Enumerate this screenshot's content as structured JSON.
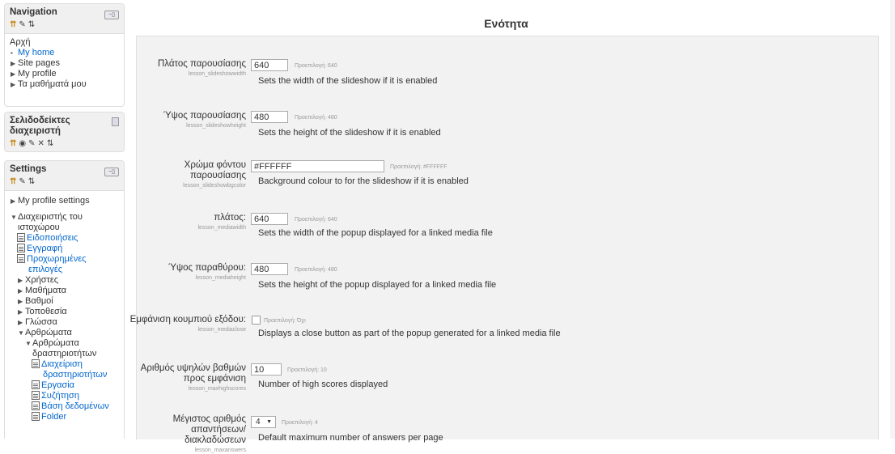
{
  "navigation": {
    "title": "Navigation",
    "home": "Αρχή",
    "items": [
      {
        "label": "My home",
        "marker": "▪"
      },
      {
        "label": "Site pages",
        "marker": "▶"
      },
      {
        "label": "My profile",
        "marker": "▶"
      },
      {
        "label": "Τα μαθήματά μου",
        "marker": "▶"
      }
    ]
  },
  "bookmarks": {
    "title_line1": "Σελιδοδείκτες",
    "title_line2": "διαχειριστή"
  },
  "settings": {
    "title": "Settings",
    "items": [
      {
        "label": "My profile settings",
        "marker": "▶"
      },
      {
        "label": "Διαχειριστής του",
        "marker": "▼"
      },
      {
        "label": "ιστοχώρου",
        "marker": ""
      },
      {
        "label": "Ειδοποιήσεις",
        "marker": "doc"
      },
      {
        "label": "Εγγραφή",
        "marker": "doc"
      },
      {
        "label": "Προχωρημένες",
        "marker": "doc"
      },
      {
        "label": "επιλογές",
        "marker": ""
      },
      {
        "label": "Χρήστες",
        "marker": "▶"
      },
      {
        "label": "Μαθήματα",
        "marker": "▶"
      },
      {
        "label": "Βαθμοί",
        "marker": "▶"
      },
      {
        "label": "Τοποθεσία",
        "marker": "▶"
      },
      {
        "label": "Γλώσσα",
        "marker": "▶"
      },
      {
        "label": "Αρθρώματα",
        "marker": "▼"
      },
      {
        "label": "Αρθρώματα",
        "marker": "▼"
      },
      {
        "label": "δραστηριοτήτων",
        "marker": ""
      },
      {
        "label": "Διαχείριση",
        "marker": "doc"
      },
      {
        "label": "δραστηριοτήτων",
        "marker": ""
      },
      {
        "label": "Εργασία",
        "marker": "doc"
      },
      {
        "label": "Συζήτηση",
        "marker": "doc"
      },
      {
        "label": "Βάση δεδομένων",
        "marker": "doc"
      },
      {
        "label": "Folder",
        "marker": "doc"
      }
    ]
  },
  "page": {
    "title": "Ενότητα"
  },
  "form": {
    "slideshowwidth": {
      "label": "Πλάτος παρουσίασης",
      "key": "lesson_slideshowwidth",
      "value": "640",
      "default": "Προεπιλογή: 640",
      "desc": "Sets the width of the slideshow if it is enabled"
    },
    "slideshowheight": {
      "label": "Ύψος παρουσίασης",
      "key": "lesson_slideshowheight",
      "value": "480",
      "default": "Προεπιλογή: 480",
      "desc": "Sets the height of the slideshow if it is enabled"
    },
    "slideshowbgcolor": {
      "label_line1": "Χρώμα φόντου",
      "label_line2": "παρουσίασης",
      "key": "lesson_slideshowbgcolor",
      "value": "#FFFFFF",
      "default": "Προεπιλογή: #FFFFFF",
      "desc": "Background colour to for the slideshow if it is enabled"
    },
    "mediawidth": {
      "label": "πλάτος:",
      "key": "lesson_mediawidth",
      "value": "640",
      "default": "Προεπιλογή: 640",
      "desc": "Sets the width of the popup displayed for a linked media file"
    },
    "mediaheight": {
      "label": "Ύψος παραθύρου:",
      "key": "lesson_mediaheight",
      "value": "480",
      "default": "Προεπιλογή: 480",
      "desc": "Sets the height of the popup displayed for a linked media file"
    },
    "mediaclose": {
      "label": "Εμφάνιση κουμπιού εξόδου:",
      "key": "lesson_mediaclose",
      "checked": false,
      "default": "Προεπιλογή: Όχι",
      "desc": "Displays a close button as part of the popup generated for a linked media file"
    },
    "maxhighscores": {
      "label_line1": "Αριθμός υψηλών βαθμών",
      "label_line2": "προς εμφάνιση",
      "key": "lesson_maxhighscores",
      "value": "10",
      "default": "Προεπιλογή: 10",
      "desc": "Number of high scores displayed"
    },
    "maxanswers": {
      "label_line1": "Μέγιστος αριθμός",
      "label_line2": "απαντήσεων/διακλαδώσεων",
      "key": "lesson_maxanswers",
      "value": "4",
      "default": "Προεπιλογή: 4",
      "desc": "Default maximum number of answers per page"
    }
  }
}
